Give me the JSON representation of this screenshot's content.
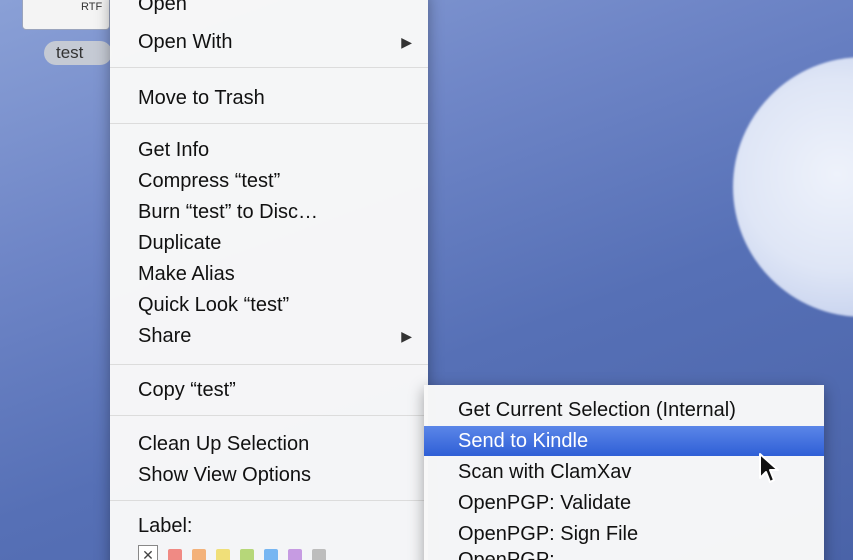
{
  "desktop": {
    "file": {
      "ext_label": "RTF",
      "name_label": "test"
    }
  },
  "context_menu": {
    "items": [
      {
        "label": "Open"
      },
      {
        "label": "Open With",
        "submenu": true
      },
      {
        "label": "Move to Trash"
      },
      {
        "label": "Get Info"
      },
      {
        "label": "Compress “test”"
      },
      {
        "label": "Burn “test” to Disc…"
      },
      {
        "label": "Duplicate"
      },
      {
        "label": "Make Alias"
      },
      {
        "label": "Quick Look “test”"
      },
      {
        "label": "Share",
        "submenu": true
      },
      {
        "label": "Copy “test”"
      },
      {
        "label": "Clean Up Selection"
      },
      {
        "label": "Show View Options"
      },
      {
        "label": "Label:"
      }
    ],
    "label_swatch_colors": [
      "#f08a84",
      "#f3b27a",
      "#f0df79",
      "#b6d779",
      "#77b6f2",
      "#c69be2",
      "#bdbdbd"
    ]
  },
  "services_submenu": {
    "items": [
      {
        "label": "Get Current Selection (Internal)"
      },
      {
        "label": "Send to Kindle",
        "selected": true
      },
      {
        "label": "Scan with ClamXav"
      },
      {
        "label": "OpenPGP: Validate"
      },
      {
        "label": "OpenPGP: Sign File"
      },
      {
        "label": "OpenPGP: ..."
      }
    ]
  },
  "colors": {
    "selection": "#3366dd",
    "menu_bg": "#f8f8f8"
  }
}
